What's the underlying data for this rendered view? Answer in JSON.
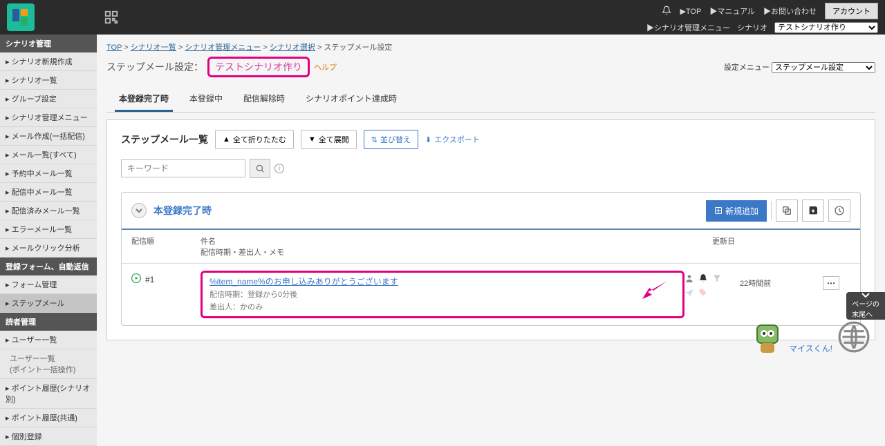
{
  "topbar": {
    "links": {
      "top": "TOP",
      "manual": "マニュアル",
      "contact": "お問い合わせ",
      "account": "アカウント"
    },
    "row2": {
      "scenario_menu": "シナリオ管理メニュー",
      "scenario_label": "シナリオ",
      "scenario_selected": "テストシナリオ作り"
    }
  },
  "sidebar": {
    "g1": {
      "hdr": "シナリオ管理",
      "items": [
        "シナリオ新規作成",
        "シナリオ一覧",
        "グループ設定",
        "シナリオ管理メニュー",
        "メール作成(一括配信)",
        "メール一覧(すべて)",
        "予約中メール一覧",
        "配信中メール一覧",
        "配信済みメール一覧",
        "エラーメール一覧",
        "メールクリック分析"
      ]
    },
    "g2": {
      "hdr": "登録フォーム、自動返信",
      "items": [
        "フォーム管理",
        "ステップメール"
      ]
    },
    "g3": {
      "hdr": "読者管理",
      "items": [
        "ユーザー一覧",
        "ユーザー一覧\n(ポイント一括操作)",
        "ポイント履歴(シナリオ別)",
        "ポイント履歴(共通)",
        "個別登録"
      ]
    }
  },
  "breadcrumb": [
    "TOP",
    "シナリオ一覧",
    "シナリオ管理メニュー",
    "シナリオ選択",
    "ステップメール設定"
  ],
  "page": {
    "title": "ステップメール設定：",
    "scenario": "テストシナリオ作り",
    "help": "ヘルプ",
    "setting_menu_label": "設定メニュー",
    "setting_menu_value": "ステップメール設定"
  },
  "tabs": [
    "本登録完了時",
    "本登録中",
    "配信解除時",
    "シナリオポイント達成時"
  ],
  "panel": {
    "title": "ステップメール一覧",
    "fold": "全て折りたたむ",
    "expand": "全て展開",
    "sort": "並び替え",
    "export": "エクスポート",
    "search_placeholder": "キーワード"
  },
  "section": {
    "title": "本登録完了時",
    "add": "新規追加",
    "head": {
      "order": "配信順",
      "subject": "件名",
      "subject2": "配信時期・差出人・メモ",
      "date": "更新日"
    },
    "row": {
      "order": "#1",
      "subject": "%item_name%のお申し込みありがとうございます",
      "timing": "配信時期：登録から0分後",
      "from": "差出人：かのみ",
      "date": "22時間前"
    }
  },
  "float": {
    "pagetop": "ページの\n末尾へ",
    "mascot": "マイスくん!"
  }
}
